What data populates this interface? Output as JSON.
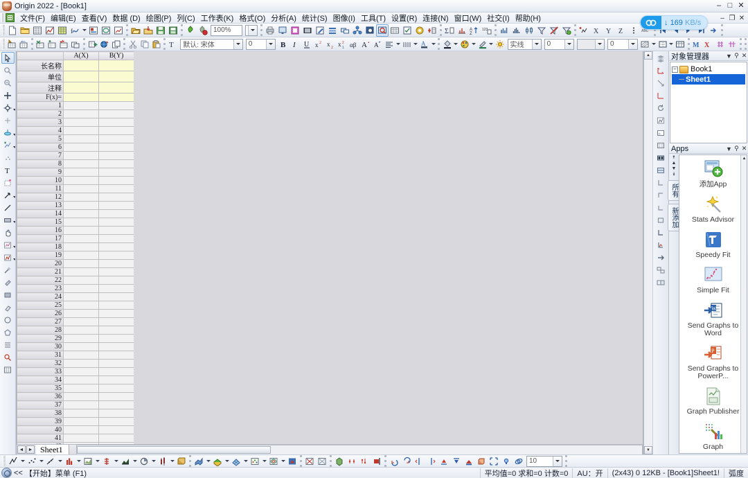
{
  "window": {
    "title": "Origin 2022 - [Book1]",
    "app_icon": "origin-logo-icon",
    "minimize": "–",
    "maximize": "□",
    "close": "✕"
  },
  "menubar": {
    "items": [
      {
        "label": "文件(F)"
      },
      {
        "label": "编辑(E)"
      },
      {
        "label": "查看(V)"
      },
      {
        "label": "数据 (D)"
      },
      {
        "label": "绘图(P)"
      },
      {
        "label": "列(C)"
      },
      {
        "label": "工作表(K)"
      },
      {
        "label": "格式(O)"
      },
      {
        "label": "分析(A)"
      },
      {
        "label": "统计(S)"
      },
      {
        "label": "图像(I)"
      },
      {
        "label": "工具(T)"
      },
      {
        "label": "设置(R)"
      },
      {
        "label": "连接(N)"
      },
      {
        "label": "窗口(W)"
      },
      {
        "label": "社交(I)"
      },
      {
        "label": "帮助(H)"
      }
    ],
    "child_minimize": "–",
    "child_restore": "❐",
    "child_close": "✕"
  },
  "standard_toolbar": {
    "zoom_value": "100%",
    "buttons": [
      "new-project-icon",
      "new-folder-icon",
      "new-workbook-icon",
      "new-graph-icon",
      "new-matrix-icon",
      "new-function-icon",
      "new-layout-icon",
      "new-notes-icon",
      "new-excel-icon",
      "open-icon",
      "import-icon",
      "save-project-icon",
      "save-window-icon",
      "run-script-icon",
      "stop-script-icon"
    ],
    "buttons2": [
      "print-icon",
      "print-preview-icon",
      "copy-page-icon",
      "movie-icon",
      "edit-icon",
      "stack-icon",
      "merge-icon",
      "layer-manage-icon",
      "zoom-panel-icon",
      "zoom-region-icon",
      "grid-icon",
      "checklist-icon",
      "refresh-icon",
      "add-column-icon"
    ],
    "buttons3": [
      "sum-stats-icon",
      "stats-icon",
      "sort-asc-icon",
      "format-cells-icon",
      "bar-stats-icon",
      "histogram-icon",
      "boxplot-icon",
      "filter-icon",
      "clear-filter-icon",
      "recalc-icon",
      "add-mask-icon",
      "x-axis-icon",
      "y-axis-icon",
      "z-axis-icon",
      "more-icon",
      "math-icon",
      "first-icon",
      "prev-icon",
      "next-icon",
      "last-icon",
      "goto-icon"
    ]
  },
  "format_toolbar": {
    "font_name": "默认: 宋体",
    "font_size": "0",
    "line_style": "实线",
    "line_width": "0",
    "fill_value": "0",
    "buttons": [
      "add-col-icon",
      "add-rows-icon",
      "delete-col-icon",
      "insert-col-icon",
      "move-col-icon",
      "copy-col-icon",
      "add-sheet-icon",
      "sphere-icon",
      "duplicate-icon",
      "cut-icon",
      "copy-icon",
      "paste-icon"
    ],
    "style_buttons": [
      "bold-icon",
      "italic-icon",
      "underline-icon",
      "superscript-icon",
      "subscript-icon",
      "sub-super-icon",
      "greek-icon",
      "increase-font-icon",
      "decrease-font-icon",
      "align-icon",
      "columns-icon",
      "font-color-icon"
    ],
    "fill_buttons": [
      "fill-color-icon",
      "palette-icon",
      "line-color-icon",
      "brightness-icon"
    ],
    "pattern_buttons": [
      "pattern-icon",
      "border-icon",
      "table-border-icon"
    ],
    "mask_buttons": [
      "mask-icon",
      "unmask-icon",
      "swap-icon",
      "shift-icon"
    ]
  },
  "left_toolbar": {
    "tools": [
      {
        "name": "pointer-tool-icon",
        "selected": true
      },
      {
        "name": "zoom-in-tool-icon",
        "selected": false
      },
      {
        "name": "zoom-out-tool-icon",
        "selected": false
      },
      {
        "name": "data-reader-icon",
        "selected": false
      },
      {
        "name": "screen-reader-icon",
        "selected": false,
        "arrow": true
      },
      {
        "name": "data-selector-icon",
        "selected": false
      },
      {
        "name": "draw-data-icon",
        "selected": false,
        "arrow": true
      },
      {
        "name": "regional-mask-icon",
        "selected": false,
        "arrow": true
      },
      {
        "name": "scatter-mask-icon",
        "selected": false
      },
      {
        "name": "text-tool-icon",
        "selected": false
      },
      {
        "name": "object-edit-icon",
        "selected": false
      },
      {
        "name": "arrow-tool-icon",
        "selected": false,
        "arrow": true
      },
      {
        "name": "line-tool-icon",
        "selected": false
      },
      {
        "name": "rectangle-tool-icon",
        "selected": false,
        "arrow": true
      },
      {
        "name": "hand-tool-icon",
        "selected": false
      },
      {
        "name": "region-plot-icon",
        "selected": false,
        "arrow": true
      },
      {
        "name": "graph-tool-icon",
        "selected": false,
        "arrow": true
      },
      {
        "name": "magic-wand-icon",
        "selected": false
      },
      {
        "name": "paint-tool-icon",
        "selected": false
      },
      {
        "name": "gradient-tool-icon",
        "selected": false
      },
      {
        "name": "eraser-tool-icon",
        "selected": false
      },
      {
        "name": "circle-tool-icon",
        "selected": false
      },
      {
        "name": "polygon-tool-icon",
        "selected": false
      },
      {
        "name": "list-tool-icon",
        "selected": false
      },
      {
        "name": "zoom-sel-icon",
        "selected": false
      },
      {
        "name": "grid-tool-icon",
        "selected": false
      }
    ]
  },
  "right_toolbar": {
    "tools": [
      "stack-layers-icon",
      "arrow-up-right-icon",
      "arrow-down-left-icon",
      "arrow-up-icon",
      "rotate-icon",
      "speed-mode-icon",
      "layer1-icon",
      "layer2-icon",
      "layer3-icon",
      "layer4-icon",
      "align-bl-icon",
      "align-tl-icon",
      "align-br-icon",
      "align-center-icon",
      "align-l-icon",
      "plot-setup-icon",
      "expand-icon",
      "merge-graphs-icon",
      "extract-icon"
    ]
  },
  "worksheet": {
    "book_name": "Book1",
    "columns": [
      {
        "label": "A(X)"
      },
      {
        "label": "B(Y)"
      }
    ],
    "meta_rows": [
      "长名称",
      "单位",
      "注释",
      "F(x)="
    ],
    "data_row_count": 42,
    "sheet_tab": "Sheet1",
    "nav_first": "◄",
    "nav_last": "►"
  },
  "object_manager": {
    "title": "对象管理器",
    "menu_icon": "▼",
    "pin_icon": "⚲",
    "close_icon": "✕",
    "tree": {
      "expander": "−",
      "root": "Book1",
      "child": "Sheet1"
    }
  },
  "apps_panel": {
    "title": "Apps",
    "menu_icon": "▼",
    "pin_icon": "⚲",
    "close_icon": "✕",
    "side_tabs": [
      "所有",
      "新添加"
    ],
    "scroll_up": "▲",
    "scroll_down": "▼",
    "items": [
      {
        "label": "添加App",
        "icon": "add-app-icon"
      },
      {
        "label": "Stats Advisor",
        "icon": "stats-advisor-icon"
      },
      {
        "label": "Speedy Fit",
        "icon": "speedy-fit-icon"
      },
      {
        "label": "Simple Fit",
        "icon": "simple-fit-icon"
      },
      {
        "label": "Send Graphs to Word",
        "icon": "send-graphs-word-icon"
      },
      {
        "label": "Send Graphs to PowerP...",
        "icon": "send-graphs-powerpoint-icon"
      },
      {
        "label": "Graph Publisher",
        "icon": "graph-publisher-icon"
      },
      {
        "label": "Graph",
        "icon": "graph-maker-icon"
      }
    ]
  },
  "bottom_toolbar": {
    "point_size": "10",
    "plot_buttons": [
      "line-plot-icon",
      "scatter-plot-icon",
      "line-symbol-icon",
      "column-plot-icon",
      "area-plot-icon",
      "stacked-plot-icon",
      "fill-area-icon",
      "pie-chart-icon",
      "floating-bar-icon",
      "3d-bar-icon"
    ],
    "graph3d_buttons": [
      "3d-surface-icon",
      "3d-colormap-icon",
      "3d-wire-icon",
      "3d-scatter-icon",
      "contour-icon",
      "heatmap-icon"
    ],
    "mask_buttons": [
      "mask-points-icon",
      "unmask-points-icon",
      "hide-icon",
      "show-icon",
      "mask-range-icon",
      "mask-tool-icon",
      "mask-all-icon"
    ],
    "layer_buttons": [
      "rotate-left-icon",
      "rotate-right-icon",
      "tilt-left-icon",
      "tilt-right-icon",
      "increase-perspective-icon",
      "decrease-perspective-icon",
      "resize-icon",
      "3d-box-icon",
      "fit-frame-icon",
      "light-icon",
      "3d-rotate-icon"
    ]
  },
  "network_widget": {
    "icon": "cloud-icon",
    "arrow": "↓",
    "speed": "169",
    "unit": "KB/s"
  },
  "statusbar": {
    "start_icon": "search-icon",
    "collapse": "<<",
    "hint": "【开始】菜单 (F1)",
    "stats": "平均值=0 求和=0 计数=0",
    "au": "AU：开",
    "dims": "(2x43) 0 12KB - [Book1]Sheet1!",
    "angle_unit": "弧度"
  }
}
